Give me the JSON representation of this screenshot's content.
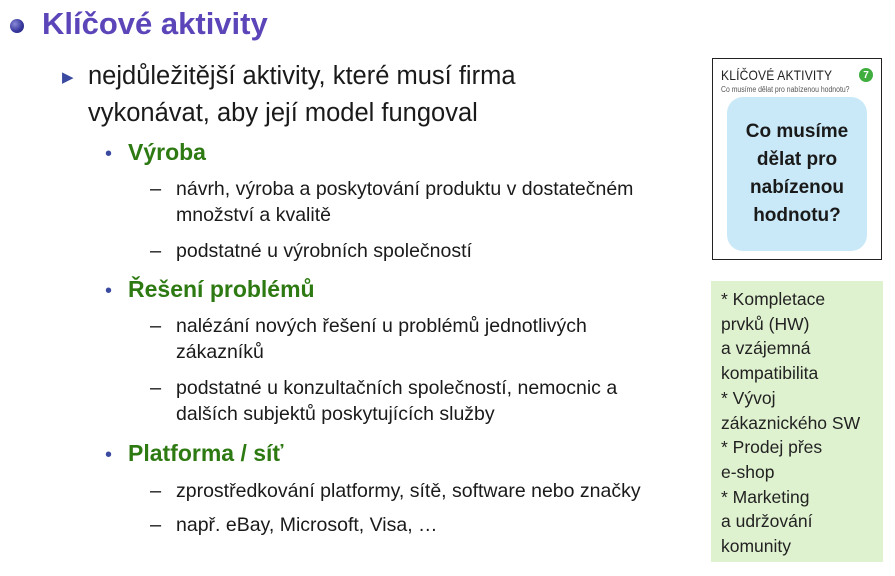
{
  "title": "Klíčové aktivity",
  "intro": "nejdůležitější aktivity, které musí firma vykonávat, aby její model fungoval",
  "sections": [
    {
      "heading": "Výroba",
      "items": [
        "návrh, výroba a poskytování produktu v dostatečném množství a kvalitě",
        "podstatné u výrobních společností"
      ]
    },
    {
      "heading": "Řešení problémů",
      "items": [
        "nalézání nových řešení u problémů jednotlivých zákazníků",
        "podstatné u konzultačních společností, nemocnic a dalších subjektů poskytujících služby"
      ]
    },
    {
      "heading": "Platforma / síť",
      "items": [
        "zprostředkování platformy, sítě, software nebo značky",
        "např. eBay, Microsoft, Visa, …"
      ]
    }
  ],
  "dash": "–",
  "card": {
    "title": "KLÍČOVÉ AKTIVITY",
    "subtitle": "Co musíme dělat pro nabízenou hodnotu?",
    "badge": "7",
    "question": "Co musíme dělat pro nabízenou hodnotu?"
  },
  "notes": [
    "* Kompletace",
    "prvků (HW)",
    "a vzájemná",
    "kompatibilita",
    "* Vývoj",
    "zákaznického SW",
    "* Prodej přes",
    "e-shop",
    "* Marketing",
    "a udržování",
    "komunity"
  ],
  "colors": {
    "title": "#5b45b8",
    "heading": "#2e7a12",
    "bubble": "#c9e9f8",
    "notes_bg": "#dff2cf",
    "badge": "#3fae3f"
  }
}
